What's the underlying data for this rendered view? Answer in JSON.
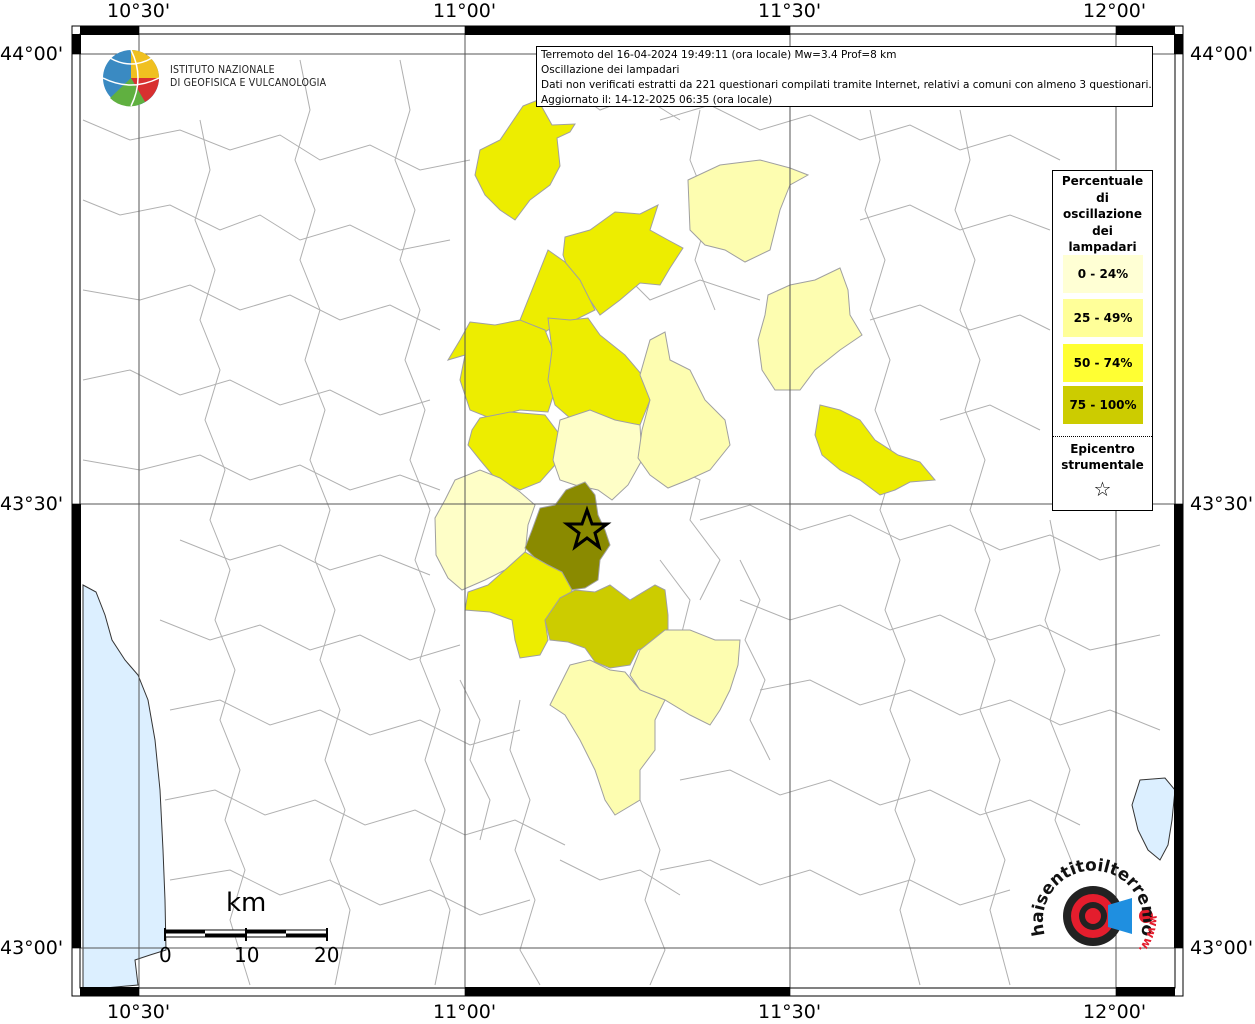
{
  "ticks": {
    "lon_top": [
      "10°30'",
      "11°00'",
      "11°30'",
      "12°00'"
    ],
    "lon_bottom": [
      "10°30'",
      "11°00'",
      "11°30'",
      "12°00'"
    ],
    "lat_left": [
      "44°00'",
      "43°30'",
      "43°00'"
    ],
    "lat_right": [
      "44°00'",
      "43°30'",
      "43°00'"
    ]
  },
  "logo": {
    "line1": "ISTITUTO NAZIONALE",
    "line2": "DI GEOFISICA E VULCANOLOGIA"
  },
  "info": {
    "line1": "Terremoto del 16-04-2024 19:49:11 (ora locale) Mw=3.4 Prof=8 km",
    "line2": "Oscillazione dei lampadari",
    "line3": "Dati non verificati estratti da 221 questionari compilati tramite Internet, relativi a comuni con almeno 3 questionari.",
    "line4": "Aggiornato il: 14-12-2025 06:35 (ora locale)"
  },
  "legend": {
    "title_lines": [
      "Percentuale",
      "di",
      "oscillazione",
      "dei",
      "lampadari"
    ],
    "classes": [
      {
        "label": "0 - 24%",
        "color": "#ffffd4"
      },
      {
        "label": "25 - 49%",
        "color": "#ffff99"
      },
      {
        "label": "50 - 74%",
        "color": "#ffff33"
      },
      {
        "label": "75 - 100%",
        "color": "#cccc00"
      }
    ],
    "epicenter_lines": [
      "Epicentro",
      "strumentale"
    ],
    "epicenter_symbol": "☆"
  },
  "fill_colors": {
    "c0": "#fefec7",
    "c1": "#fdfdb0",
    "c2": "#eded00",
    "c3": "#cccc00",
    "epicentre_zone": "#8a8a00",
    "sea": "#dcefff"
  },
  "scale": {
    "unit": "km",
    "labels": [
      "0",
      "10",
      "20"
    ]
  },
  "haisentito": {
    "text": "haisentitoilterremoto.it",
    "www": "www."
  }
}
